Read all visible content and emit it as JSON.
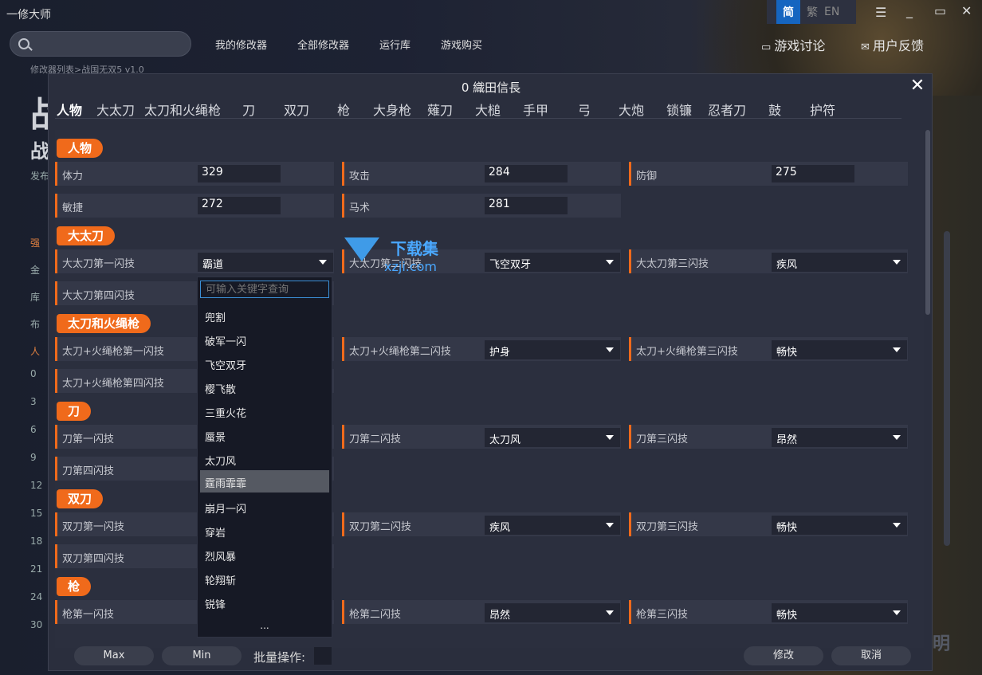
{
  "app": {
    "title": "一修大师",
    "search_placeholder": ""
  },
  "nav": [
    "我的修改器",
    "全部修改器",
    "运行库",
    "游戏购买"
  ],
  "lang": {
    "simplified": "简",
    "traditional": "繁",
    "english": "EN"
  },
  "topright": {
    "discuss": "游戏讨论",
    "feedback": "用户反馈"
  },
  "breadcrumb": "修改器列表>战国无双5 v1.0",
  "bg_side": {
    "head1": "战",
    "head2": "战",
    "publish": "发布",
    "s1": "强",
    "s2": "金",
    "s3": "库",
    "s4": "布",
    "s5": "人",
    "nums": [
      "0",
      "3",
      "6",
      "9",
      "12",
      "15",
      "18",
      "21",
      "24",
      "30"
    ],
    "right": "明"
  },
  "modal": {
    "title": "0 織田信長",
    "close": "✕",
    "tabs": [
      "人物",
      "大太刀",
      "太刀和火绳枪",
      "刀",
      "双刀",
      "枪",
      "大身枪",
      "薙刀",
      "大槌",
      "手甲",
      "弓",
      "大炮",
      "锁镰",
      "忍者刀",
      "鼓",
      "护符"
    ],
    "sections": {
      "s1": "人物",
      "s2": "大太刀",
      "s3": "太刀和火绳枪",
      "s4": "刀",
      "s5": "双刀",
      "s6": "枪"
    },
    "fields": {
      "stamina": {
        "label": "体力",
        "value": "329"
      },
      "attack": {
        "label": "攻击",
        "value": "284"
      },
      "defense": {
        "label": "防御",
        "value": "275"
      },
      "agility": {
        "label": "敏捷",
        "value": "272"
      },
      "horse": {
        "label": "马术",
        "value": "281"
      },
      "odachi1": {
        "label": "大太刀第一闪技",
        "value": "霸道"
      },
      "odachi2": {
        "label": "大太刀第二闪技",
        "value": "飞空双牙"
      },
      "odachi3": {
        "label": "大太刀第三闪技",
        "value": "疾风"
      },
      "odachi4": {
        "label": "大太刀第四闪技",
        "value": ""
      },
      "tachi1": {
        "label": "太刀+火绳枪第一闪技",
        "value": ""
      },
      "tachi2": {
        "label": "太刀+火绳枪第二闪技",
        "value": "护身"
      },
      "tachi3": {
        "label": "太刀+火绳枪第三闪技",
        "value": "畅快"
      },
      "tachi4": {
        "label": "太刀+火绳枪第四闪技",
        "value": ""
      },
      "katana1": {
        "label": "刀第一闪技",
        "value": ""
      },
      "katana2": {
        "label": "刀第二闪技",
        "value": "太刀风"
      },
      "katana3": {
        "label": "刀第三闪技",
        "value": "昂然"
      },
      "katana4": {
        "label": "刀第四闪技",
        "value": ""
      },
      "dual1": {
        "label": "双刀第一闪技",
        "value": ""
      },
      "dual2": {
        "label": "双刀第二闪技",
        "value": "疾风"
      },
      "dual3": {
        "label": "双刀第三闪技",
        "value": "畅快"
      },
      "dual4": {
        "label": "双刀第四闪技",
        "value": ""
      },
      "spear1": {
        "label": "枪第一闪技",
        "value": ""
      },
      "spear2": {
        "label": "枪第二闪技",
        "value": "昂然"
      },
      "spear3": {
        "label": "枪第三闪技",
        "value": "畅快"
      }
    },
    "dropdown": {
      "placeholder": "可输入关键字查询",
      "items": [
        "兜割",
        "破军一闪",
        "飞空双牙",
        "樱飞散",
        "三重火花",
        "蜃景",
        "太刀风",
        "霆雨霏霏",
        "崩月一闪",
        "穿岩",
        "烈风暴",
        "轮翔斩",
        "锐锋"
      ],
      "highlighted": "霆雨霏霏",
      "more": "..."
    },
    "footer": {
      "max": "Max",
      "min": "Min",
      "batch": "批量操作:",
      "modify": "修改",
      "cancel": "取消"
    }
  },
  "watermark": {
    "line1": "下载集",
    "line2": "xzji.com"
  }
}
